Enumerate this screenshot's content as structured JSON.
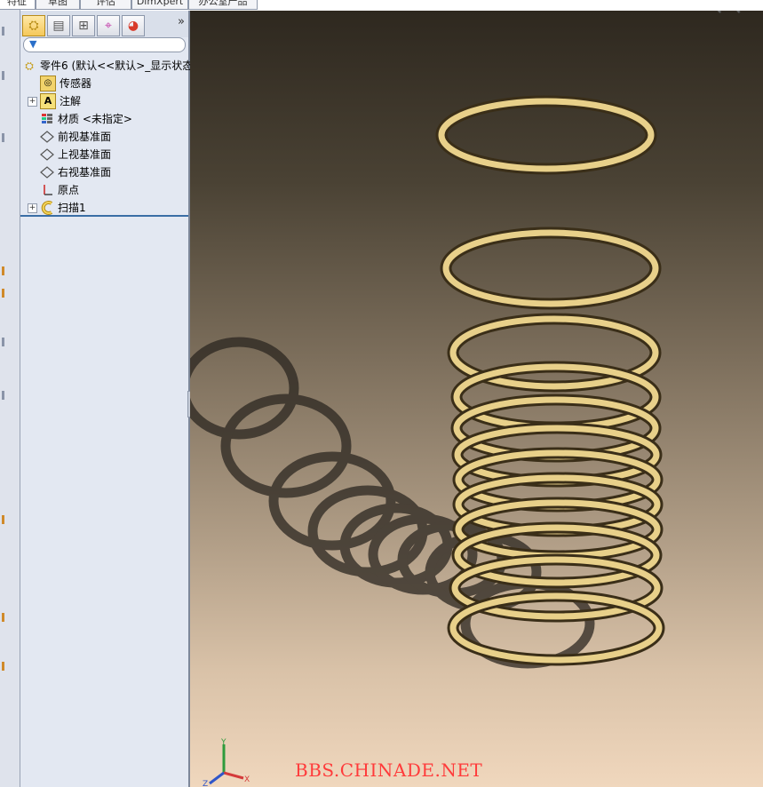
{
  "tabs": [
    {
      "label": "特征"
    },
    {
      "label": "草图"
    },
    {
      "label": "评估"
    },
    {
      "label": "DimXpert"
    },
    {
      "label": "办公室产品"
    }
  ],
  "feature_tree": {
    "filter_icon": "filter-icon",
    "expand_label": "»",
    "items": [
      {
        "label": "零件6  (默认<<默认>_显示状态",
        "icon": "part-icon"
      },
      {
        "label": "传感器",
        "icon": "sensor-icon"
      },
      {
        "label": "注解",
        "icon": "annotation-icon"
      },
      {
        "label": "材质 <未指定>",
        "icon": "material-icon"
      },
      {
        "label": "前视基准面",
        "icon": "plane-icon"
      },
      {
        "label": "上视基准面",
        "icon": "plane-icon"
      },
      {
        "label": "右视基准面",
        "icon": "plane-icon"
      },
      {
        "label": "原点",
        "icon": "origin-icon"
      },
      {
        "label": "扫描1",
        "icon": "sweep-icon"
      }
    ]
  },
  "triad": {
    "x": "X",
    "y": "Y",
    "z": "Z"
  },
  "watermark": "BBS.CHINADE.NET",
  "colors": {
    "spring": "#e8d08a",
    "triad_x": "#d43a3a",
    "triad_y": "#2e9b3c",
    "triad_z": "#3056c9",
    "watermark": "#ff3b3b"
  }
}
